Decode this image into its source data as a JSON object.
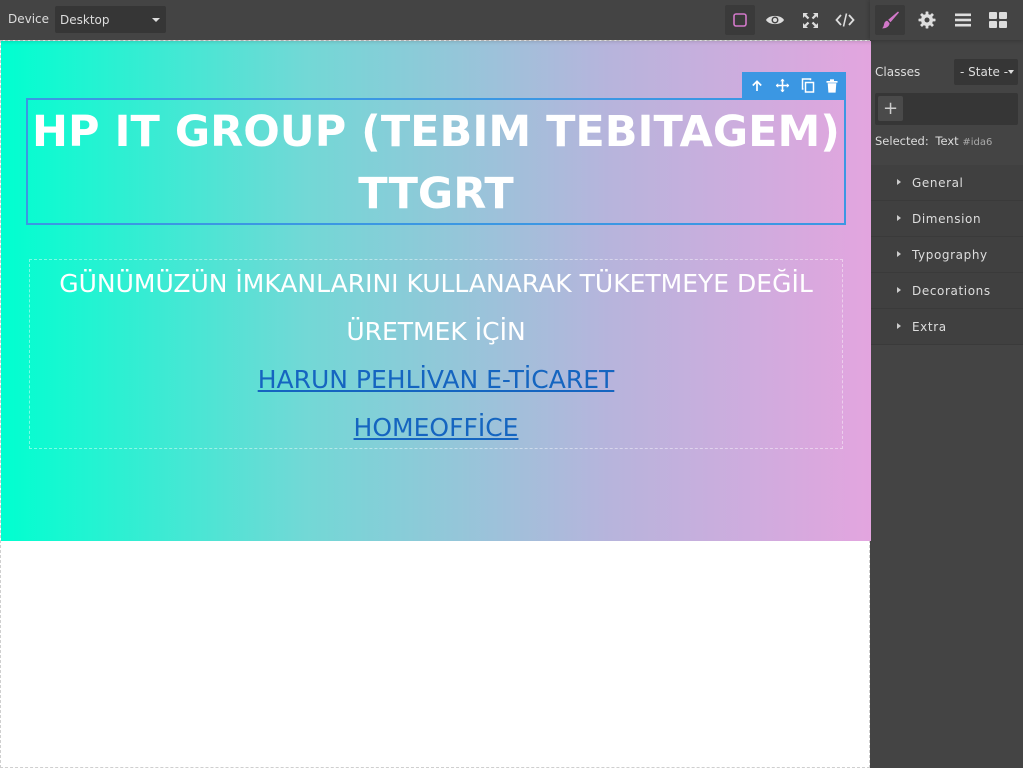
{
  "topbar": {
    "device_label": "Device",
    "device_value": "Desktop"
  },
  "panel": {
    "classes_label": "Classes",
    "state_value": "- State -",
    "add_class_symbol": "+",
    "selected_prefix": "Selected:",
    "selected_name": "Text",
    "selected_id": "#ida6",
    "sectors": [
      {
        "label": "General"
      },
      {
        "label": "Dimension"
      },
      {
        "label": "Typography"
      },
      {
        "label": "Decorations"
      },
      {
        "label": "Extra"
      }
    ]
  },
  "hero": {
    "title": "HP IT GROUP (TEBIM TEBITAGEM) TTGRT",
    "line1": "GÜNÜMÜZÜN İMKANLARINI KULLANARAK TÜKETMEYE DEĞİL",
    "line2": "ÜRETMEK İÇİN",
    "link1": "HARUN PEHLİVAN E-TİCARET",
    "link2": "HOMEOFFİCE"
  },
  "colors": {
    "accent": "#3b97e3",
    "panel_bg": "#444444",
    "brush_active": "#d278c9",
    "gradient_start": "#00ffd0",
    "gradient_end": "#e3a5df",
    "link": "#1565c0"
  },
  "icons": {
    "topbar": [
      "square-outline-icon",
      "eye-icon",
      "fullscreen-icon",
      "code-icon"
    ],
    "panel_tabs": [
      "paint-brush-icon",
      "gear-icon",
      "layers-icon",
      "blocks-icon"
    ],
    "element_toolbar": [
      "arrow-up-icon",
      "move-icon",
      "copy-icon",
      "trash-icon"
    ]
  }
}
